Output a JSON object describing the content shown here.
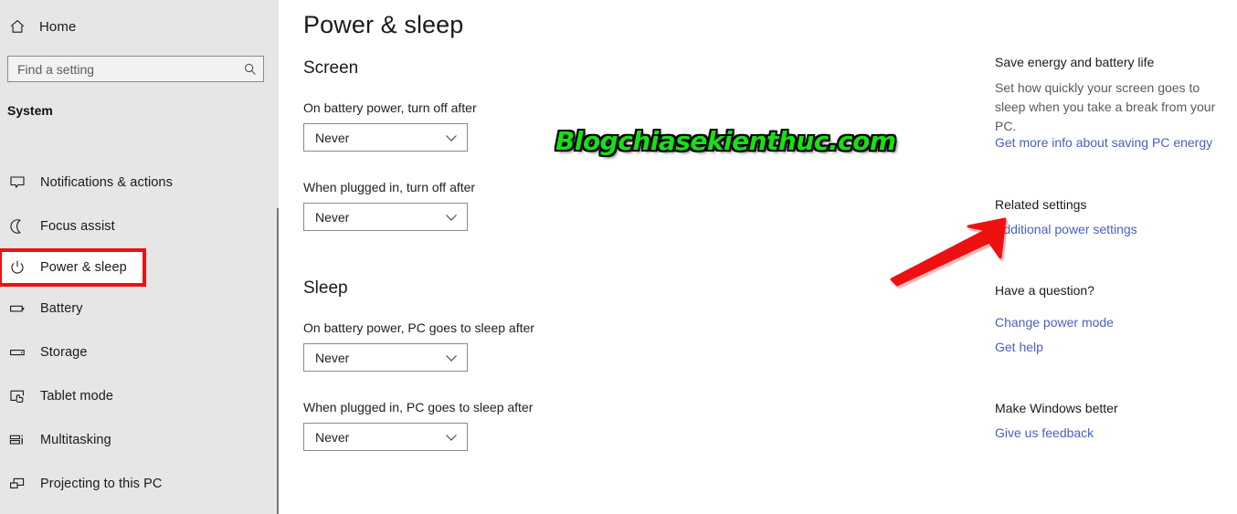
{
  "sidebar": {
    "home_label": "Home",
    "home_icon": "home-icon",
    "search": {
      "placeholder": "Find a setting",
      "value": "",
      "icon": "search-icon"
    },
    "section_header": "System",
    "items": [
      {
        "label": "Notifications & actions",
        "icon": "notification-bubble-icon",
        "selected": false
      },
      {
        "label": "Focus assist",
        "icon": "moon-icon",
        "selected": false
      },
      {
        "label": "Power & sleep",
        "icon": "power-icon",
        "selected": true
      },
      {
        "label": "Battery",
        "icon": "battery-icon",
        "selected": false
      },
      {
        "label": "Storage",
        "icon": "storage-drive-icon",
        "selected": false
      },
      {
        "label": "Tablet mode",
        "icon": "tablet-touch-icon",
        "selected": false
      },
      {
        "label": "Multitasking",
        "icon": "multitasking-icon",
        "selected": false
      },
      {
        "label": "Projecting to this PC",
        "icon": "projecting-icon",
        "selected": false
      }
    ]
  },
  "main": {
    "page_title": "Power & sleep",
    "groups": [
      {
        "title": "Screen",
        "fields": [
          {
            "label": "On battery power, turn off after",
            "value": "Never"
          },
          {
            "label": "When plugged in, turn off after",
            "value": "Never"
          }
        ]
      },
      {
        "title": "Sleep",
        "fields": [
          {
            "label": "On battery power, PC goes to sleep after",
            "value": "Never"
          },
          {
            "label": "When plugged in, PC goes to sleep after",
            "value": "Never"
          }
        ]
      }
    ]
  },
  "right_panel": {
    "save_energy": {
      "heading": "Save energy and battery life",
      "body": "Set how quickly your screen goes to sleep when you take a break from your PC.",
      "link": "Get more info about saving PC energy"
    },
    "related_settings": {
      "heading": "Related settings",
      "link": "Additional power settings"
    },
    "have_question": {
      "heading": "Have a question?",
      "link1": "Change power mode",
      "link2": "Get help"
    },
    "make_better": {
      "heading": "Make Windows better",
      "link": "Give us feedback"
    }
  },
  "annotations": {
    "watermark_text": "Blogchiasekienthuc.com",
    "watermark_color": "#16e016",
    "highlight_color": "#ee1111",
    "arrow_color": "#ee1111",
    "link_color": "#4a5fc1"
  }
}
